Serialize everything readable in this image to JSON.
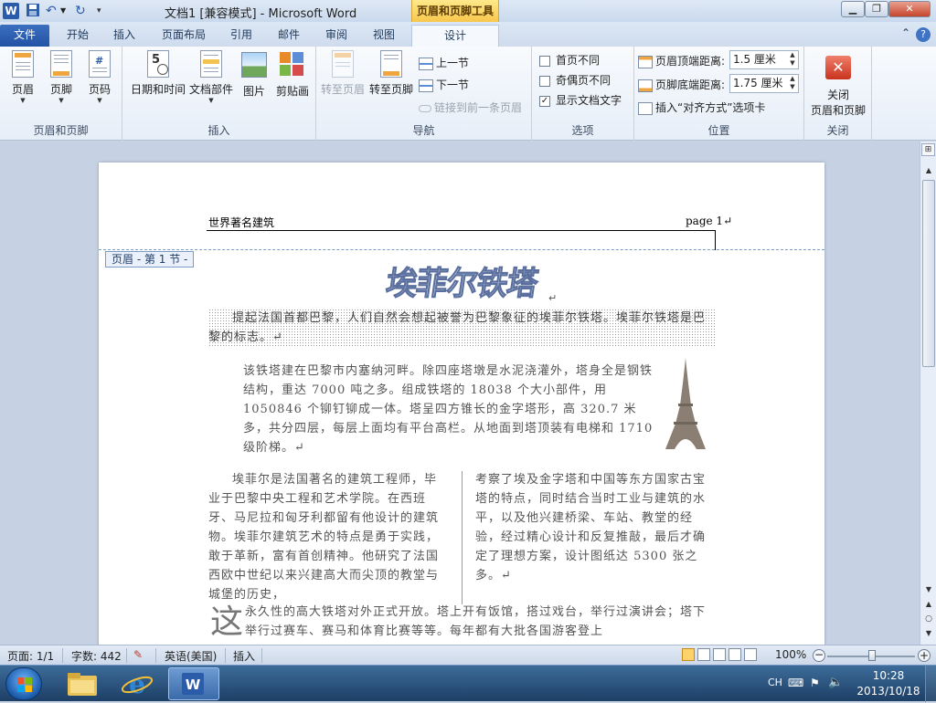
{
  "titlebar": {
    "app_icon": "W",
    "title": "文档1 [兼容模式] - Microsoft Word",
    "context_title": "页眉和页脚工具"
  },
  "tabs": [
    {
      "label": "文件"
    },
    {
      "label": "开始"
    },
    {
      "label": "插入"
    },
    {
      "label": "页面布局"
    },
    {
      "label": "引用"
    },
    {
      "label": "邮件"
    },
    {
      "label": "审阅"
    },
    {
      "label": "视图"
    },
    {
      "label": "设计"
    }
  ],
  "ribbon": {
    "hf_group": {
      "label": "页眉和页脚",
      "header": "页眉",
      "footer": "页脚",
      "page_number": "页码"
    },
    "insert_group": {
      "label": "插入",
      "datetime": "日期和时间",
      "quickparts": "文档部件",
      "picture": "图片",
      "clipart": "剪贴画"
    },
    "nav_group": {
      "label": "导航",
      "goto_header": "转至页眉",
      "goto_footer": "转至页脚",
      "previous": "上一节",
      "next": "下一节",
      "link_previous": "链接到前一条页眉"
    },
    "options_group": {
      "label": "选项",
      "different_first": "首页不同",
      "different_odd_even": "奇偶页不同",
      "show_doc_text": "显示文档文字"
    },
    "position_group": {
      "label": "位置",
      "header_from_top": "页眉顶端距离:",
      "header_from_top_value": "1.5 厘米",
      "footer_from_bottom": "页脚底端距离:",
      "footer_from_bottom_value": "1.75 厘米",
      "insert_align_tab": "插入“对齐方式”选项卡"
    },
    "close_group": {
      "label": "关闭",
      "close_line1": "关闭",
      "close_line2": "页眉和页脚"
    }
  },
  "document": {
    "header_left": "世界著名建筑",
    "header_right": "page 1↵",
    "header_tag": "页眉 - 第 1 节 -",
    "wordart": "埃菲尔铁塔",
    "wordart_mark": "↵",
    "para1": "提起法国首都巴黎，人们自然会想起被誉为巴黎象征的埃菲尔铁塔。埃菲尔铁塔是巴黎的标志。↵",
    "para2": "该铁塔建在巴黎市内塞纳河畔。除四座塔墩是水泥浇灌外，塔身全是钢铁结构，重达 7000 吨之多。组成铁塔的 18038 个大小部件，用 1050846 个铆钉铆成一体。塔呈四方锥长的金字塔形，高 320.7 米多，共分四层，每层上面均有平台高栏。从地面到塔顶装有电梯和 1710 级阶梯。↵",
    "para3": "埃菲尔是法国著名的建筑工程师，毕业于巴黎中央工程和艺术学院。在西班牙、马尼拉和匈牙利都留有他设计的建筑物。埃菲尔建筑艺术的特点是勇于实践，敢于革新，富有首创精神。他研究了法国西欧中世纪以来兴建高大而尖顶的教堂与城堡的历史，",
    "para4": "考察了埃及金字塔和中国等东方国家古宝塔的特点，同时结合当时工业与建筑的水平，以及他兴建桥梁、车站、教堂的经验，经过精心设计和反复推敲，最后才确定了理想方案，设计图纸达 5300 张之多。↵",
    "dropcap": "这",
    "para5": "永久性的高大铁塔对外正式开放。塔上开有饭馆，搭过戏台，举行过演讲会；塔下举行过赛车、赛马和体育比赛等等。每年都有大批各国游客登上"
  },
  "statusbar": {
    "page": "页面: 1/1",
    "words": "字数: 442",
    "language": "英语(美国)",
    "mode": "插入",
    "zoom": "100%",
    "zoom_out": "−",
    "zoom_in": "+"
  },
  "taskbar": {
    "lang": "CH",
    "time": "10:28",
    "date": "2013/10/18"
  },
  "colors": {
    "file_tab": "#2253a5",
    "context_tab": "#f7c74c",
    "close_button": "#c5452c"
  }
}
